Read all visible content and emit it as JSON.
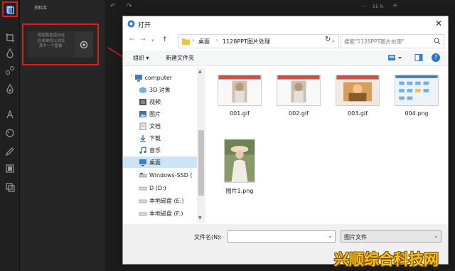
{
  "app": {
    "library_title": "资料库",
    "library_hint": [
      "将图像拖曳到此",
      "处或单机以浏览",
      "其中一个图像."
    ],
    "zoom": "51 %",
    "zoom_minus": "-",
    "zoom_plus": "+"
  },
  "dialog": {
    "title": "打开",
    "close": "✕",
    "breadcrumb": [
      "桌面",
      "1128PPT图片处理"
    ],
    "search_placeholder": "搜索\"1128PPT图片处理\"",
    "toolbar": {
      "organize": "组织 ▾",
      "new_folder": "新建文件夹",
      "help": "?"
    },
    "nav_items": [
      {
        "label": "computer",
        "icon": "computer-icon"
      },
      {
        "label": "3D 对象",
        "icon": "3d-objects-icon"
      },
      {
        "label": "视频",
        "icon": "video-icon"
      },
      {
        "label": "图片",
        "icon": "pictures-icon"
      },
      {
        "label": "文档",
        "icon": "documents-icon"
      },
      {
        "label": "下载",
        "icon": "download-icon"
      },
      {
        "label": "音乐",
        "icon": "music-icon"
      },
      {
        "label": "桌面",
        "icon": "desktop-icon"
      },
      {
        "label": "Windows-SSD (",
        "icon": "drive-icon"
      },
      {
        "label": "D (D:)",
        "icon": "drive-icon"
      },
      {
        "label": "本地磁盘 (E:)",
        "icon": "drive-icon"
      },
      {
        "label": "本地磁盘 (F:)",
        "icon": "drive-icon"
      }
    ],
    "files": [
      {
        "name": "001.gif"
      },
      {
        "name": "002.gif"
      },
      {
        "name": "003.gif"
      },
      {
        "name": "004.png"
      },
      {
        "name": "图片1.png"
      }
    ],
    "filename_label": "文件名(N):",
    "filename_value": "",
    "filetype": "图片文件"
  },
  "watermark": "兴顺综合科技网",
  "colors": {
    "highlight_red": "#d02020",
    "selection_blue": "#cce4f7",
    "dark_bg": "#1a1a1a"
  }
}
